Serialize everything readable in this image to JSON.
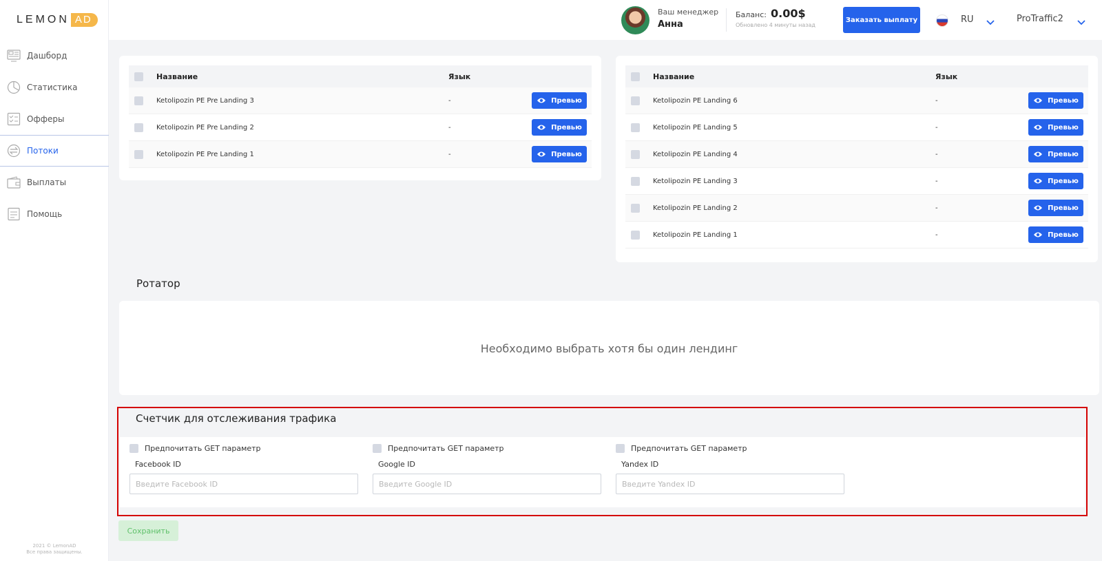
{
  "logo": {
    "part1": "LEMON",
    "part2": "AD"
  },
  "sidebar": {
    "items": [
      {
        "label": "Дашборд",
        "icon": "dashboard-icon"
      },
      {
        "label": "Статистика",
        "icon": "chart-icon"
      },
      {
        "label": "Офферы",
        "icon": "offers-icon"
      },
      {
        "label": "Потоки",
        "icon": "flows-icon",
        "active": true
      },
      {
        "label": "Выплаты",
        "icon": "wallet-icon"
      },
      {
        "label": "Помощь",
        "icon": "help-icon"
      }
    ],
    "copyright_line1": "2021 © LemonAD",
    "copyright_line2": "Все права защищены."
  },
  "header": {
    "manager_label": "Ваш менеджер",
    "manager_name": "Анна",
    "balance_label": "Баланс:",
    "balance_value": "0.00$",
    "balance_updated": "Обновлено 4 минуты назад",
    "payout_button": "Заказать выплату",
    "language": "RU",
    "username": "ProTraffic2"
  },
  "prelandings": {
    "col_name": "Название",
    "col_lang": "Язык",
    "rows": [
      {
        "name": "Ketolipozin PE Pre Landing 3",
        "lang": "-",
        "button": "Превью"
      },
      {
        "name": "Ketolipozin PE Pre Landing 2",
        "lang": "-",
        "button": "Превью"
      },
      {
        "name": "Ketolipozin PE Pre Landing 1",
        "lang": "-",
        "button": "Превью"
      }
    ]
  },
  "landings": {
    "col_name": "Название",
    "col_lang": "Язык",
    "rows": [
      {
        "name": "Ketolipozin PE Landing 6",
        "lang": "-",
        "button": "Превью"
      },
      {
        "name": "Ketolipozin PE Landing 5",
        "lang": "-",
        "button": "Превью"
      },
      {
        "name": "Ketolipozin PE Landing 4",
        "lang": "-",
        "button": "Превью"
      },
      {
        "name": "Ketolipozin PE Landing 3",
        "lang": "-",
        "button": "Превью"
      },
      {
        "name": "Ketolipozin PE Landing 2",
        "lang": "-",
        "button": "Превью"
      },
      {
        "name": "Ketolipozin PE Landing 1",
        "lang": "-",
        "button": "Превью"
      }
    ]
  },
  "rotator": {
    "title": "Ротатор",
    "empty_message": "Необходимо выбрать хотя бы один лендинг"
  },
  "tracker": {
    "title": "Счетчик для отслеживания трафика",
    "fields": [
      {
        "checkbox_label": "Предпочитать GET параметр",
        "label": "Facebook ID",
        "placeholder": "Введите Facebook ID",
        "value": ""
      },
      {
        "checkbox_label": "Предпочитать GET параметр",
        "label": "Google ID",
        "placeholder": "Введите Google ID",
        "value": ""
      },
      {
        "checkbox_label": "Предпочитать GET параметр",
        "label": "Yandex ID",
        "placeholder": "Введите Yandex ID",
        "value": ""
      }
    ]
  },
  "save_button": "Сохранить",
  "colors": {
    "accent": "#2563eb",
    "logo_ad": "#f5b74a",
    "highlight_border": "#d40000",
    "save_bg": "#d6f0d8"
  }
}
